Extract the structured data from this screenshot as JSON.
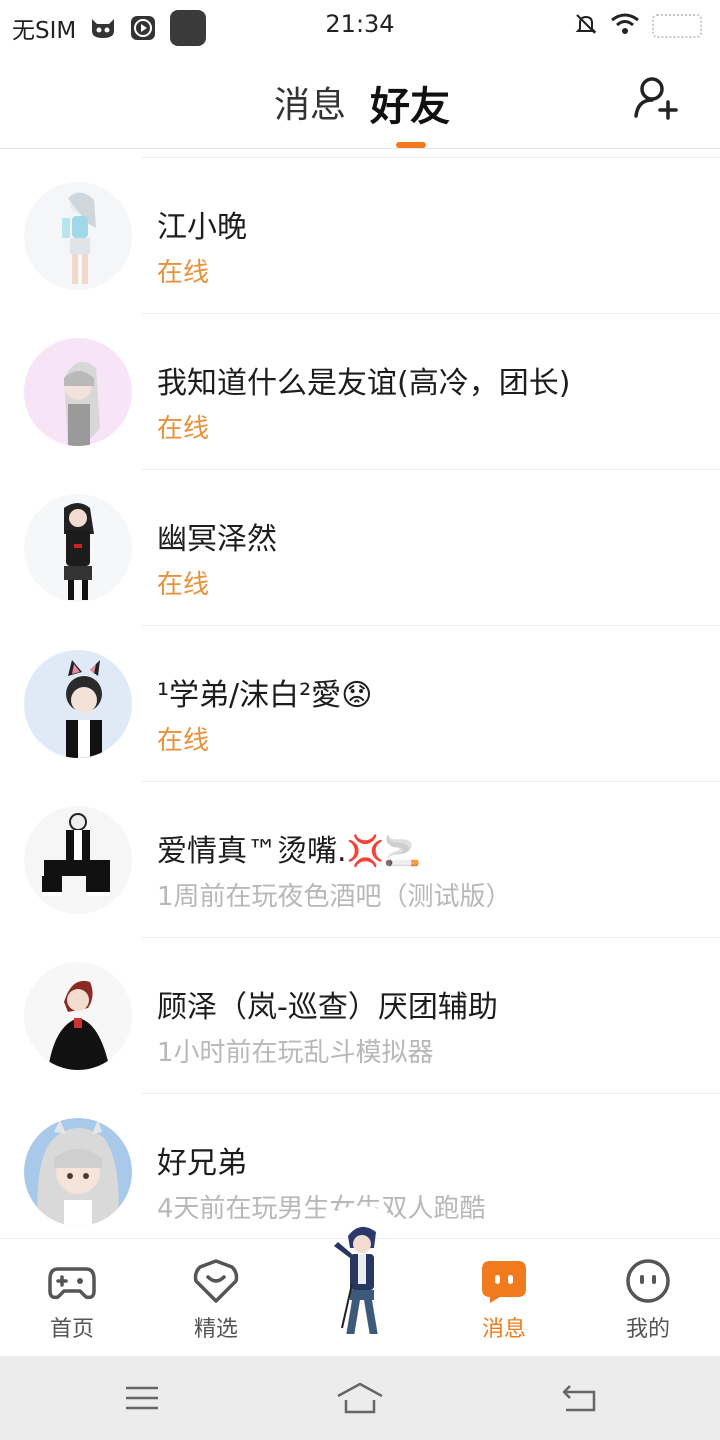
{
  "status_bar": {
    "carrier": "无SIM",
    "time": "21:34"
  },
  "header": {
    "tabs": [
      {
        "label": "消息",
        "active": false
      },
      {
        "label": "好友",
        "active": true
      }
    ],
    "accent_color": "#f27a1e"
  },
  "friends": [
    {
      "name": "江小晚",
      "status": "在线",
      "online": true
    },
    {
      "name": "我知道什么是友谊(高冷，团长)",
      "status": "在线",
      "online": true
    },
    {
      "name": "幽冥泽然",
      "status": "在线",
      "online": true
    },
    {
      "name": "¹学弟/沫白²愛😟",
      "status": "在线",
      "online": true
    },
    {
      "name": "爱情真™烫嘴.💢🚬",
      "status": "1周前在玩夜色酒吧（测试版）",
      "online": false
    },
    {
      "name": "顾泽（岚-巡查）厌团辅助",
      "status": "1小时前在玩乱斗模拟器",
      "online": false
    },
    {
      "name": "好兄弟",
      "status": "4天前在玩男生女生双人跑酷",
      "online": false
    }
  ],
  "bottom_nav": {
    "items": [
      {
        "label": "首页",
        "icon": "gamepad-icon",
        "active": false
      },
      {
        "label": "精选",
        "icon": "heart-badge-icon",
        "active": false
      },
      {
        "label": "消息",
        "icon": "chat-bubble-icon",
        "active": true
      },
      {
        "label": "我的",
        "icon": "face-icon",
        "active": false
      }
    ]
  },
  "system_bar": {
    "buttons": [
      "menu-icon",
      "home-icon",
      "back-icon"
    ]
  }
}
